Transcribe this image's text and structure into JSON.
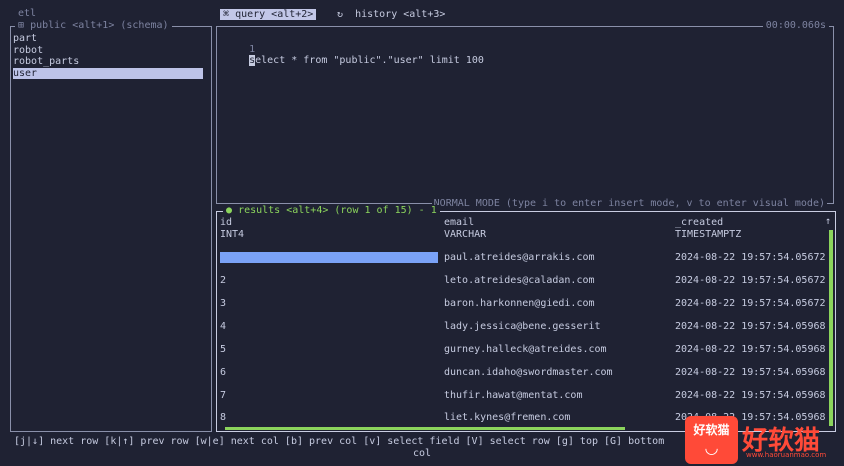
{
  "app": {
    "title": "etl"
  },
  "sidebar": {
    "header": "public <alt+1> (schema)",
    "items": [
      {
        "label": "part"
      },
      {
        "label": "robot"
      },
      {
        "label": "robot_parts"
      },
      {
        "label": "user",
        "selected": true
      }
    ]
  },
  "tabs": [
    {
      "icon": "query-icon",
      "label": "query <alt+2>",
      "active": true
    },
    {
      "icon": "history-icon",
      "label": "history <alt+3>",
      "active": false
    }
  ],
  "editor": {
    "timer": "00:00.060s",
    "line_number": "1",
    "first_char": "s",
    "query_rest": "elect * from \"public\".\"user\" limit 100",
    "mode_hint": "NORMAL MODE (type i to enter insert mode, v to enter visual mode)"
  },
  "results": {
    "title": "results <alt+4> (row 1 of 15) - 1",
    "columns": [
      {
        "name": "id",
        "type": "INT4"
      },
      {
        "name": "email",
        "type": "VARCHAR"
      },
      {
        "name": "_created",
        "type": "TIMESTAMPTZ"
      }
    ],
    "rows": [
      {
        "id": "",
        "email": "paul.atreides@arrakis.com",
        "created": "2024-08-22 19:57:54.05672"
      },
      {
        "id": "2",
        "email": "leto.atreides@caladan.com",
        "created": "2024-08-22 19:57:54.05672"
      },
      {
        "id": "3",
        "email": "baron.harkonnen@giedi.com",
        "created": "2024-08-22 19:57:54.05672"
      },
      {
        "id": "4",
        "email": "lady.jessica@bene.gesserit",
        "created": "2024-08-22 19:57:54.05968"
      },
      {
        "id": "5",
        "email": "gurney.halleck@atreides.com",
        "created": "2024-08-22 19:57:54.05968"
      },
      {
        "id": "6",
        "email": "duncan.idaho@swordmaster.com",
        "created": "2024-08-22 19:57:54.05968"
      },
      {
        "id": "7",
        "email": "thufir.hawat@mentat.com",
        "created": "2024-08-22 19:57:54.05968"
      },
      {
        "id": "8",
        "email": "liet.kynes@fremen.com",
        "created": "2024-08-22 19:57:54.05968"
      }
    ],
    "scroll_up": "↑",
    "colors": {
      "accent": "#8bd45c",
      "selection": "#7aa2f7"
    }
  },
  "help": {
    "line1": "[j|↓] next row [k|↑] prev row [w|e] next col [b] prev col [v] select field [V] select row [g] top [G] bottom",
    "line2": "col"
  },
  "watermark": {
    "logo_text": "好软猫",
    "big_text": "好软猫",
    "url": "www.haoruanmao.com"
  }
}
